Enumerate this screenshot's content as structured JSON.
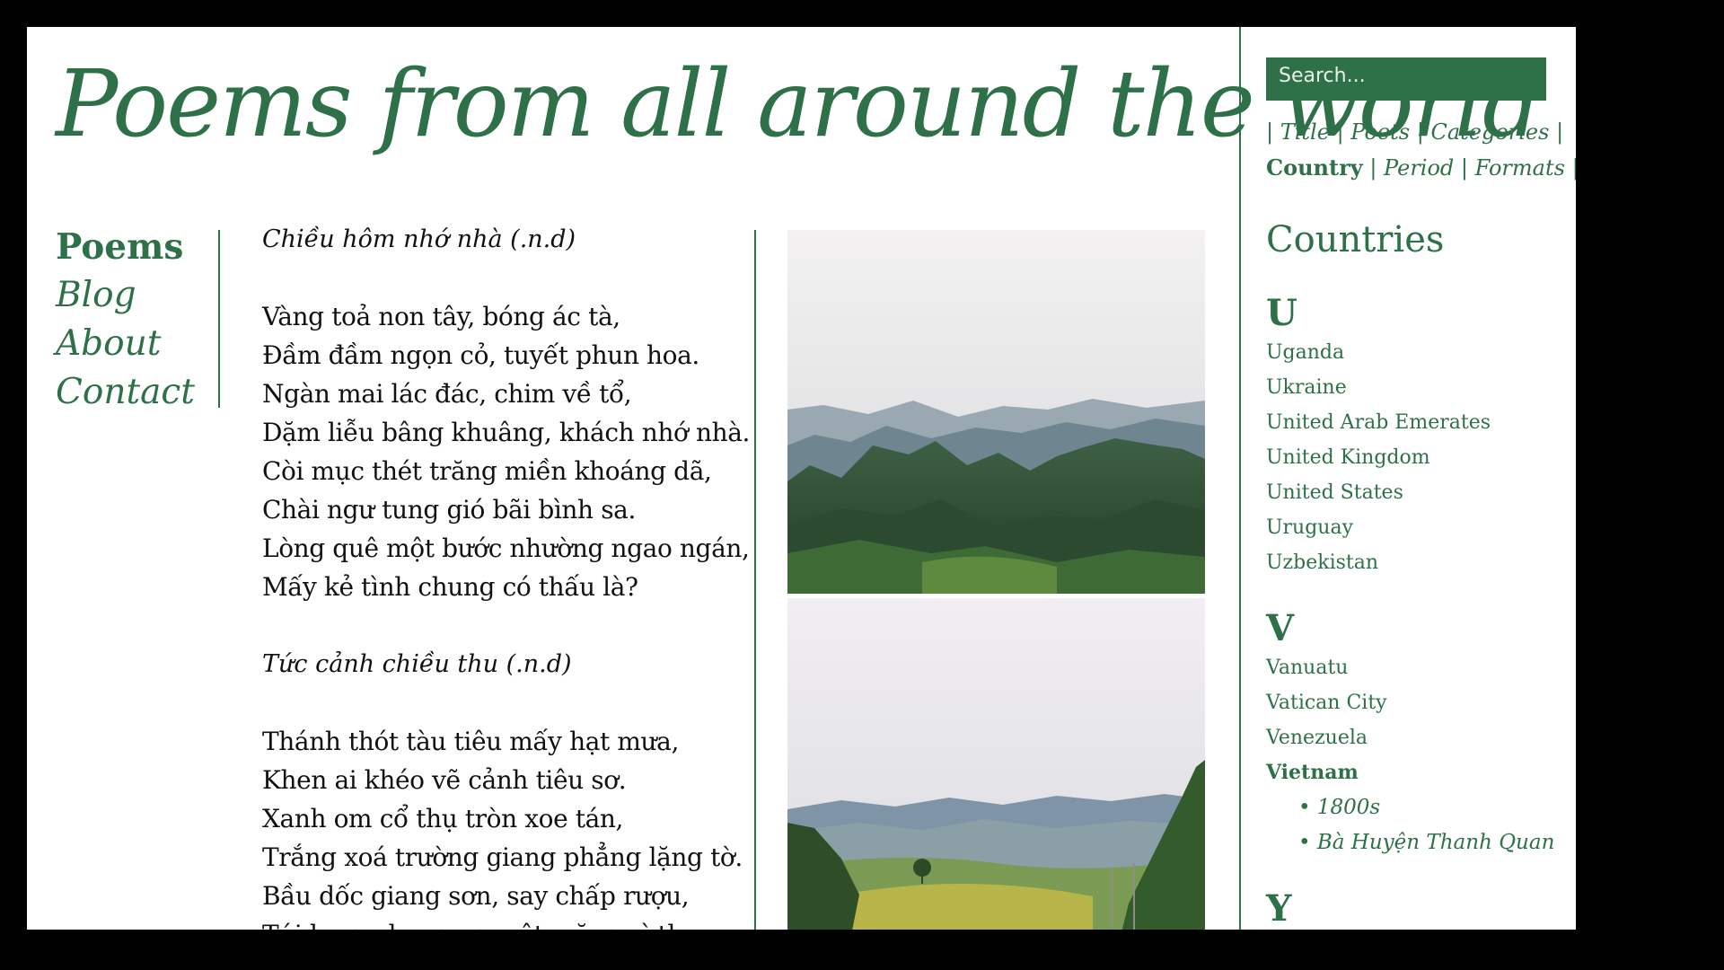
{
  "site": {
    "title": "Poems from all around the world"
  },
  "nav": [
    "Poems",
    "Blog",
    "About",
    "Contact"
  ],
  "poems": [
    {
      "title": "Chiều hôm nhớ nhà (.n.d)",
      "lines": [
        "Vàng toả non tây, bóng ác tà,",
        "Đầm đầm ngọn cỏ, tuyết phun hoa.",
        "Ngàn mai lác đác, chim về tổ,",
        "Dặm liễu bâng khuâng, khách nhớ nhà.",
        "Còi mục thét trăng miền khoáng dã,",
        "Chài ngư tung gió bãi bình sa.",
        "Lòng quê một bước nhường ngao ngán,",
        "Mấy kẻ tình chung có thấu là?"
      ]
    },
    {
      "title": "Tức cảnh chiều thu (.n.d)",
      "lines": [
        "Thánh thót tàu tiêu mấy hạt mưa,",
        "Khen ai khéo vẽ cảnh tiêu sơ.",
        "Xanh om cổ thụ tròn xoe tán,",
        "Trắng xoá trường giang phẳng lặng tờ.",
        "Bầu dốc giang sơn, say chấp rượu,",
        "Túi lưng phong nguyệt, nặng vì thơ."
      ]
    }
  ],
  "search": {
    "placeholder": "Search..."
  },
  "filters": [
    "Title",
    "Poets",
    "Categories",
    "Country",
    "Period",
    "Formats"
  ],
  "countries": {
    "heading": "Countries",
    "groups": [
      {
        "letter": "U",
        "items": [
          "Uganda",
          "Ukraine",
          "United Arab Emerates",
          "United Kingdom",
          "United States",
          "Uruguay",
          "Uzbekistan"
        ]
      },
      {
        "letter": "V",
        "items": [
          "Vanuatu",
          "Vatican City",
          "Venezuela",
          "Vietnam"
        ]
      },
      {
        "letter": "Y",
        "items": []
      }
    ],
    "vietnam_sub": [
      "• 1800s",
      "• Bà Huyện Thanh Quan"
    ]
  },
  "colors": {
    "accent": "#2e7148",
    "text": "#111111",
    "frame": "#000000"
  }
}
